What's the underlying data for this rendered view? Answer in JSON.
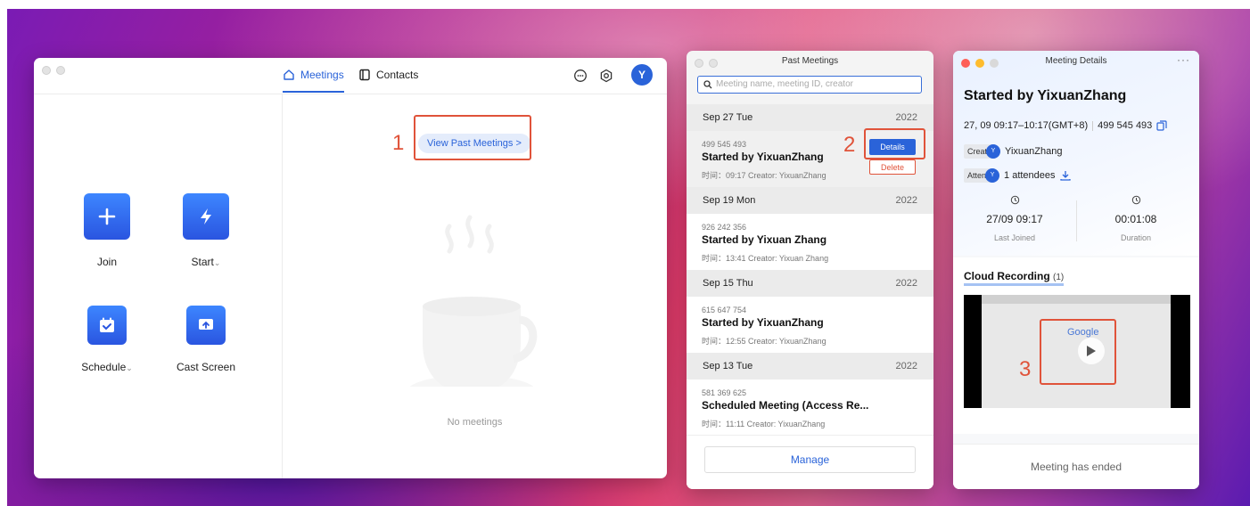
{
  "main": {
    "tabs": [
      {
        "label": "Meetings"
      },
      {
        "label": "Contacts"
      }
    ],
    "avatar": "Y",
    "actions": [
      {
        "label": "Join"
      },
      {
        "label": "Start",
        "chevron": "⌄"
      },
      {
        "label": "Schedule",
        "chevron": "⌄"
      },
      {
        "label": "Cast Screen"
      }
    ],
    "view_past_label": "View Past Meetings >",
    "empty_text": "No meetings"
  },
  "annotations": [
    "1",
    "2",
    "3"
  ],
  "past": {
    "title": "Past Meetings",
    "search_placeholder": "Meeting name, meeting ID, creator",
    "groups": [
      {
        "date": "Sep 27 Tue",
        "year": "2022",
        "id": "499 545 493",
        "name": "Started by YixuanZhang",
        "meta": "时间：09:17    Creator: YixuanZhang"
      },
      {
        "date": "Sep 19 Mon",
        "year": "2022",
        "id": "926 242 356",
        "name": "Started by Yixuan Zhang",
        "meta": "时间：13:41    Creator: Yixuan Zhang"
      },
      {
        "date": "Sep 15 Thu",
        "year": "2022",
        "id": "615 647 754",
        "name": "Started by YixuanZhang",
        "meta": "时间：12:55    Creator: YixuanZhang"
      },
      {
        "date": "Sep 13 Tue",
        "year": "2022",
        "id": "581 369 625",
        "name": "Scheduled Meeting (Access Re...",
        "meta": "时间：11:11    Creator: YixuanZhang"
      }
    ],
    "details_label": "Details",
    "delete_label": "Delete",
    "manage_label": "Manage"
  },
  "details": {
    "title": "Meeting Details",
    "more": "···",
    "heading": "Started by YixuanZhang",
    "time": "27, 09 09:17–10:17(GMT+8)",
    "meeting_id": "499 545 493",
    "creator_key": "Creato",
    "creator_avatar": "Y",
    "creator": "YixuanZhang",
    "attendees_key": "Attend",
    "attendees_avatar": "Y",
    "attendees": "1 attendees",
    "last_joined_value": "27/09 09:17",
    "last_joined_label": "Last Joined",
    "duration_value": "00:01:08",
    "duration_label": "Duration",
    "recording_title": "Cloud Recording",
    "recording_count": "(1)",
    "video_logo": "Google",
    "ended": "Meeting has ended"
  },
  "colors": {
    "accent": "#2a63d9",
    "annotation": "#e0533a"
  }
}
